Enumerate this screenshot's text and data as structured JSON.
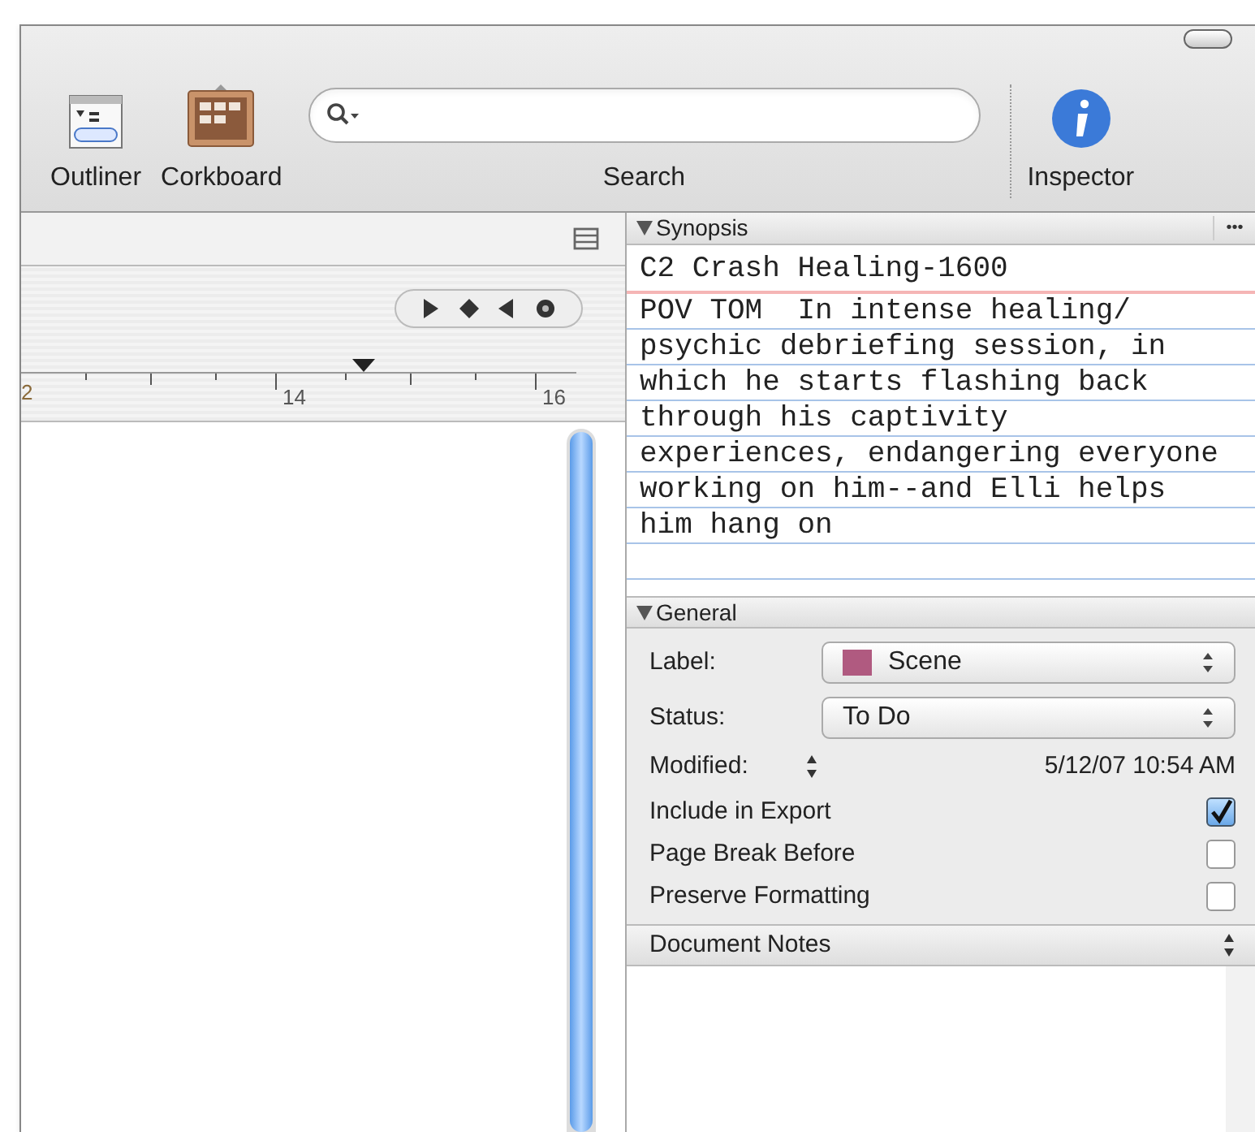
{
  "toolbar": {
    "items": [
      {
        "kind": "outliner",
        "label": "Outliner"
      },
      {
        "kind": "corkboard",
        "label": "Corkboard"
      }
    ],
    "search": {
      "label": "Search"
    },
    "inspector": {
      "label": "Inspector"
    }
  },
  "ruler": {
    "labels": [
      "2",
      "14",
      "16"
    ]
  },
  "synopsis": {
    "header": "Synopsis",
    "more": "•••",
    "title": "C2 Crash Healing-1600",
    "text": "POV TOM  In intense healing/ psychic debriefing session, in which he starts flashing back through his captivity experiences, endangering everyone working on him--and Elli helps him hang on"
  },
  "general": {
    "header": "General",
    "popups": [
      {
        "label": "Label:",
        "value": "Scene",
        "color": "#b05a80"
      },
      {
        "label": "Status:",
        "value": "To Do"
      }
    ],
    "modified": {
      "label": "Modified:",
      "value": "5/12/07 10:54 AM"
    },
    "checks": [
      {
        "label": "Include in Export",
        "checked": true
      },
      {
        "label": "Page Break Before",
        "checked": false
      },
      {
        "label": "Preserve Formatting",
        "checked": false
      }
    ]
  },
  "notes": {
    "header": "Document Notes"
  }
}
